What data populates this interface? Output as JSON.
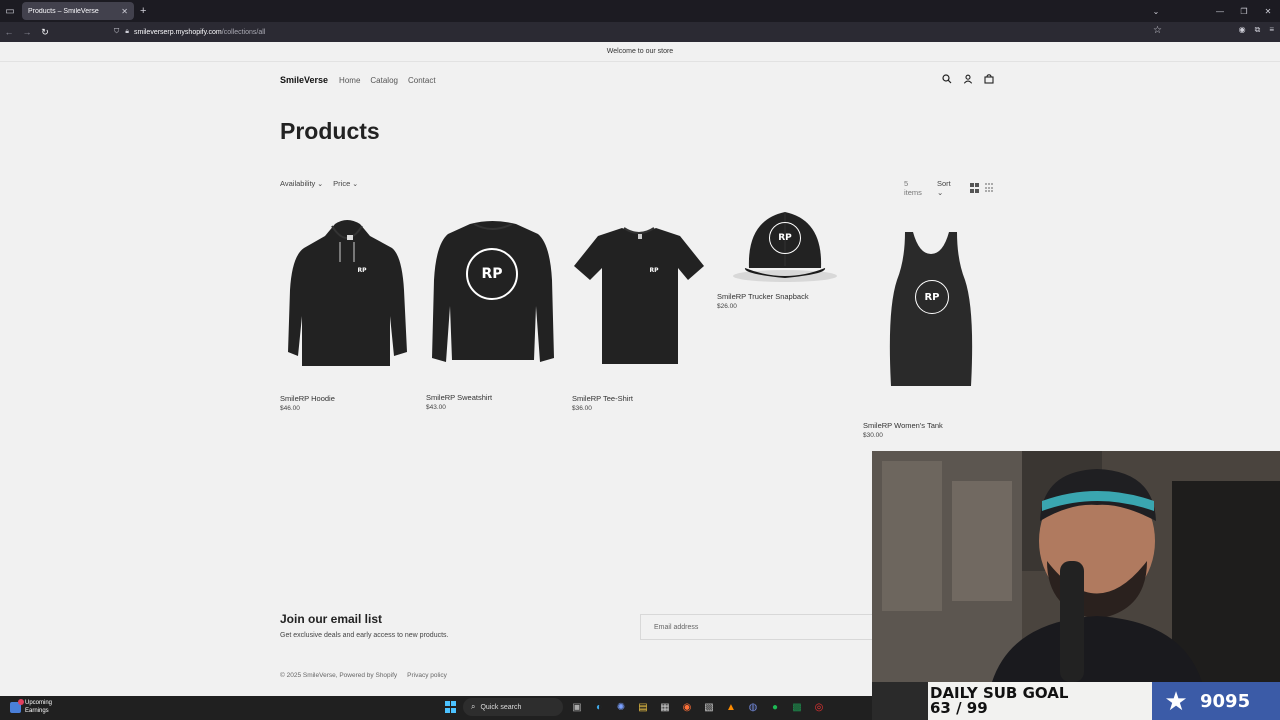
{
  "browser": {
    "tab_title": "Products – SmileVerse",
    "url_host": "smileverserp.myshopify.com",
    "url_path": "/collections/all"
  },
  "store": {
    "announcement": "Welcome to our store",
    "logo": "SmileVerse",
    "menu": [
      "Home",
      "Catalog",
      "Contact"
    ],
    "page_title": "Products",
    "filters": [
      "Availability",
      "Price"
    ],
    "item_count": "5 items",
    "sort_label": "Sort",
    "products": [
      {
        "name": "SmileRP Hoodie",
        "price": "$46.00"
      },
      {
        "name": "SmileRP Sweatshirt",
        "price": "$43.00"
      },
      {
        "name": "SmileRP Tee-Shirt",
        "price": "$36.00"
      },
      {
        "name": "SmileRP Trucker Snapback",
        "price": "$26.00"
      },
      {
        "name": "SmileRP Women's Tank",
        "price": "$30.00"
      }
    ],
    "product_logo_text": "RP",
    "email": {
      "title": "Join our email list",
      "subtitle": "Get exclusive deals and early access to new products.",
      "placeholder": "Email address"
    },
    "footer": {
      "copyright": "© 2025 SmileVerse, Powered by Shopify",
      "privacy": "Privacy policy"
    }
  },
  "overlay": {
    "goal_title": "DAILY SUB GOAL",
    "goal_progress": "63 / 99",
    "goal_number": "9095"
  },
  "taskbar": {
    "earnings_line1": "Upcoming",
    "earnings_line2": "Earnings",
    "search_label": "Quick search"
  }
}
